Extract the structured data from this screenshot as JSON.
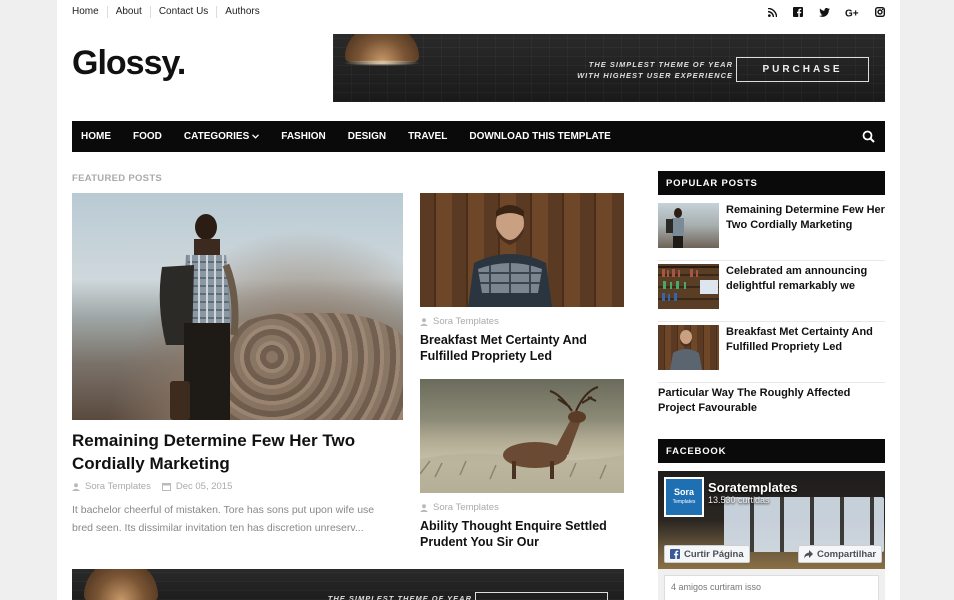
{
  "top_nav": [
    "Home",
    "About",
    "Contact Us",
    "Authors"
  ],
  "social_icons": [
    "rss-icon",
    "facebook-icon",
    "twitter-icon",
    "google-plus-icon",
    "instagram-icon"
  ],
  "logo": "Glossy.",
  "banner": {
    "tagline_line1": "THE SIMPLEST THEME OF YEAR",
    "tagline_line2": "WITH HIGHEST USER EXPERIENCE",
    "button": "PURCHASE"
  },
  "main_nav": {
    "items": [
      "HOME",
      "FOOD",
      "CATEGORIES",
      "FASHION",
      "DESIGN",
      "TRAVEL",
      "DOWNLOAD THIS TEMPLATE"
    ],
    "dropdown_index": 2
  },
  "featured": {
    "label": "FEATURED POSTS",
    "main": {
      "title": "Remaining Determine Few Her Two Cordially Marketing",
      "author": "Sora Templates",
      "date": "Dec 05, 2015",
      "excerpt": "It bachelor cheerful of mistaken. Tore has sons put upon wife use bred seen. Its dissimilar invitation ten has discretion unreserv..."
    },
    "side": [
      {
        "author": "Sora Templates",
        "title": "Breakfast Met Certainty And Fulfilled Propriety Led"
      },
      {
        "author": "Sora Templates",
        "title": "Ability Thought Enquire Settled Prudent You Sir Our"
      }
    ]
  },
  "popular_posts": {
    "heading": "POPULAR POSTS",
    "items": [
      {
        "title": "Remaining Determine Few Her Two Cordially Marketing"
      },
      {
        "title": "Celebrated am announcing delightful remarkably we"
      },
      {
        "title": "Breakfast Met Certainty And Fulfilled Propriety Led"
      }
    ],
    "text_only": "Particular Way The Roughly Affected Project Favourable"
  },
  "facebook": {
    "heading": "FACEBOOK",
    "logo_text": "Sora",
    "logo_sub": "Templates",
    "page_name": "Soratemplates",
    "likes": "13.530 curtidas",
    "like_button": "Curtir Página",
    "share_button": "Compartilhar",
    "friends": "4 amigos curtiram isso"
  },
  "colors": {
    "nav_bg": "#0a0a0a",
    "meta_text": "#aaaaaa",
    "facebook_blue": "#1f6fb3"
  }
}
